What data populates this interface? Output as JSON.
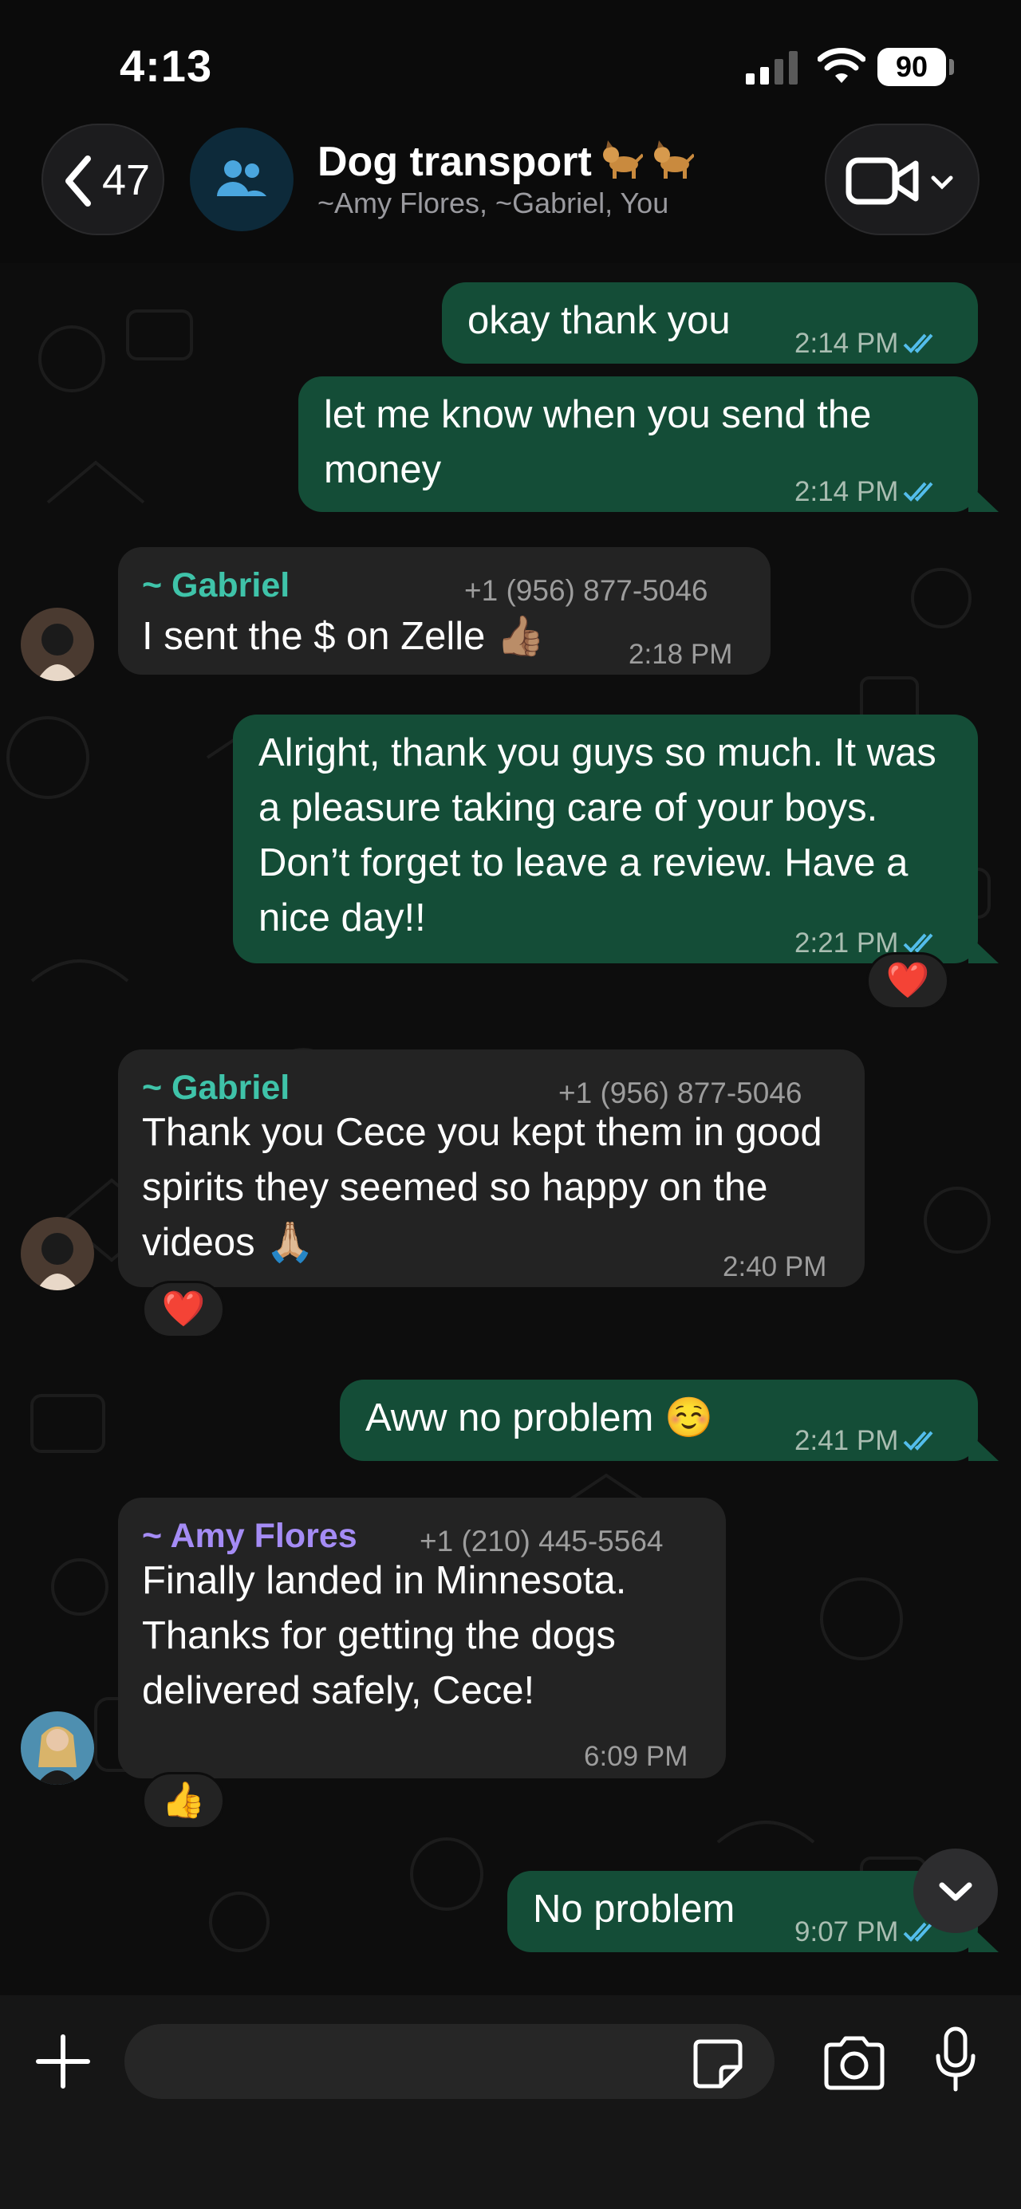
{
  "status": {
    "time": "4:13",
    "battery": "90"
  },
  "header": {
    "back_count": "47",
    "title": "Dog transport",
    "title_emoji": "dog-emoji",
    "members": "~Amy Flores, ~Gabriel, You"
  },
  "messages": [
    {
      "direction": "out",
      "text": "okay thank you",
      "time": "2:14 PM",
      "status": "read"
    },
    {
      "direction": "out",
      "text": "let me know when you send the money",
      "time": "2:14 PM",
      "status": "read"
    },
    {
      "direction": "in",
      "sender": "~ Gabriel",
      "phone": "+1 (956) 877-5046",
      "text": "I sent the $ on Zelle 👍🏽",
      "time": "2:18 PM"
    },
    {
      "direction": "out",
      "text": "Alright, thank you guys so much. It was a pleasure taking care of your boys. Don’t forget to leave a review. Have a nice day!!",
      "time": "2:21 PM",
      "status": "read",
      "reaction": "❤️"
    },
    {
      "direction": "in",
      "sender": "~ Gabriel",
      "phone": "+1 (956) 877-5046",
      "text": "Thank you Cece you kept them in good spirits they seemed so happy on the videos 🙏🏼",
      "time": "2:40 PM",
      "reaction": "❤️"
    },
    {
      "direction": "out",
      "text": "Aww no problem ☺️",
      "time": "2:41 PM",
      "status": "read"
    },
    {
      "direction": "in",
      "sender": "~ Amy Flores",
      "phone": "+1 (210) 445-5564",
      "text": "Finally landed in Minnesota. Thanks for getting the dogs delivered safely, Cece!",
      "time": "6:09 PM",
      "reaction": "👍"
    },
    {
      "direction": "out",
      "text": "No problem",
      "time": "9:07 PM",
      "status": "read"
    }
  ],
  "colors": {
    "outgoing_bubble": "#144d37",
    "incoming_bubble": "#232323",
    "gabriel_name": "#3fc3a9",
    "amy_name": "#a58cf5",
    "read_ticks": "#53bdeb"
  },
  "input": {
    "placeholder": ""
  }
}
